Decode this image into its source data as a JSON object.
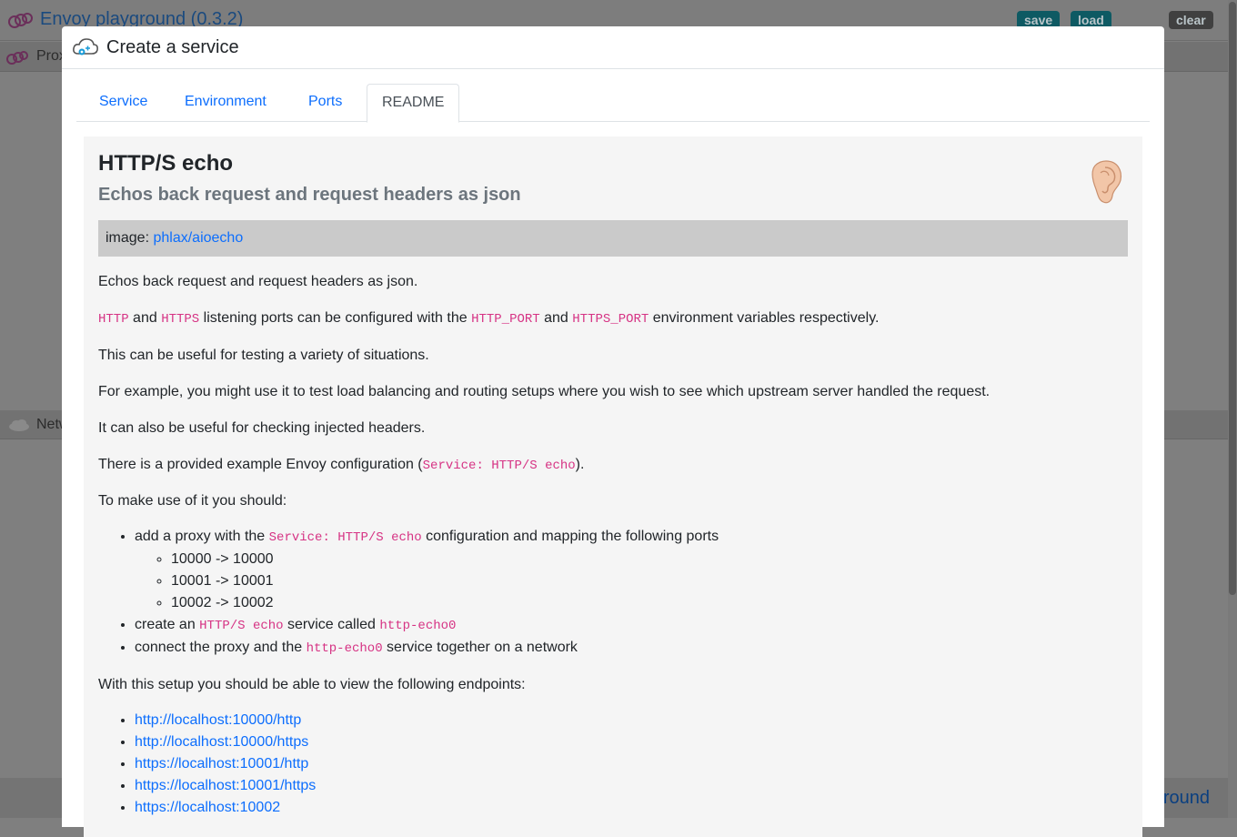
{
  "background": {
    "app_title": "Envoy playground (0.3.2)",
    "save_label": "save",
    "load_label": "load",
    "clear_label": "clear",
    "proxies_label": "Proxies",
    "networks_label": "Networks",
    "footer_link": "Envoy playground"
  },
  "modal": {
    "title": "Create a service",
    "tabs": [
      {
        "label": "Service"
      },
      {
        "label": "Environment"
      },
      {
        "label": "Ports"
      },
      {
        "label": "README"
      }
    ],
    "active_tab": "README"
  },
  "readme": {
    "title": "HTTP/S echo",
    "subtitle": "Echos back request and request headers as json",
    "image_label": "image:",
    "image_link": "phlax/aioecho",
    "p1": "Echos back request and request headers as json.",
    "p2": {
      "code1": "HTTP",
      "t1": " and ",
      "code2": "HTTPS",
      "t2": " listening ports can be configured with the ",
      "code3": "HTTP_PORT",
      "t3": " and ",
      "code4": "HTTPS_PORT",
      "t4": " environment variables respectively."
    },
    "p3": "This can be useful for testing a variety of situations.",
    "p4": "For example, you might use it to test load balancing and routing setups where you wish to see which upstream server handled the request.",
    "p5": "It can also be useful for checking injected headers.",
    "p6": {
      "t1": "There is a provided example Envoy configuration (",
      "code": "Service: HTTP/S echo",
      "t2": ")."
    },
    "p7": "To make use of it you should:",
    "steps": {
      "s1_t1": "add a proxy with the ",
      "s1_code": "Service: HTTP/S echo",
      "s1_t2": " configuration and mapping the following ports",
      "ports": [
        "10000 -> 10000",
        "10001 -> 10001",
        "10002 -> 10002"
      ],
      "s2_t1": "create an ",
      "s2_code1": "HTTP/S echo",
      "s2_t2": " service called ",
      "s2_code2": "http-echo0",
      "s3_t1": "connect the proxy and the ",
      "s3_code": "http-echo0",
      "s3_t2": " service together on a network"
    },
    "p8": "With this setup you should be able to view the following endpoints:",
    "endpoints": [
      "http://localhost:10000/http",
      "http://localhost:10000/https",
      "https://localhost:10001/http",
      "https://localhost:10001/https",
      "https://localhost:10002"
    ]
  },
  "colors": {
    "link": "#0d6efd",
    "code": "#d63384",
    "overlay": "#7f7f7f"
  }
}
